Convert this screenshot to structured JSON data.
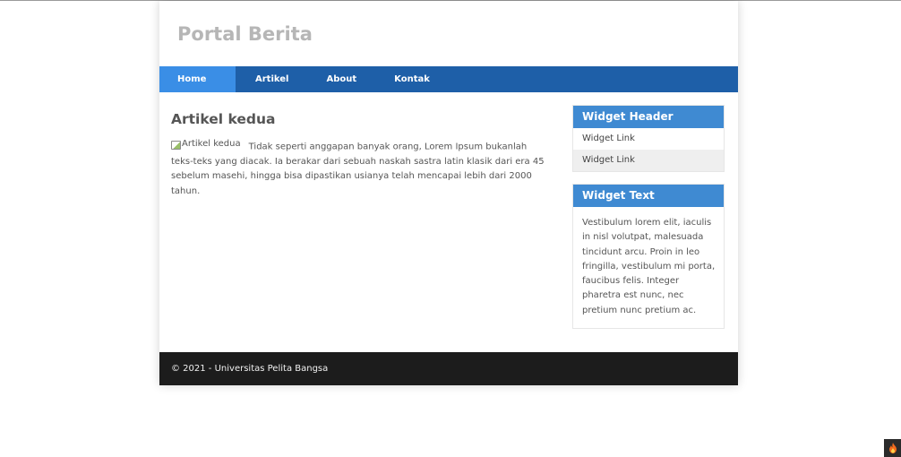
{
  "site": {
    "title": "Portal Berita"
  },
  "nav": {
    "items": [
      {
        "label": "Home",
        "active": true
      },
      {
        "label": "Artikel",
        "active": false
      },
      {
        "label": "About",
        "active": false
      },
      {
        "label": "Kontak",
        "active": false
      }
    ]
  },
  "article": {
    "title": "Artikel kedua",
    "image_alt": "Artikel kedua",
    "body": "Tidak seperti anggapan banyak orang, Lorem Ipsum bukanlah teks-teks yang diacak. Ia berakar dari sebuah naskah sastra latin klasik dari era 45 sebelum masehi, hingga bisa dipastikan usianya telah mencapai lebih dari 2000 tahun."
  },
  "sidebar": {
    "widget_links": {
      "header": "Widget Header",
      "links": [
        "Widget Link",
        "Widget Link"
      ]
    },
    "widget_text": {
      "header": "Widget Text",
      "body": "Vestibulum lorem elit, iaculis in nisl volutpat, malesuada tincidunt arcu. Proin in leo fringilla, vestibulum mi porta, faucibus felis. Integer pharetra est nunc, nec pretium nunc pretium ac."
    }
  },
  "footer": {
    "text": "© 2021 - Universitas Pelita Bangsa"
  },
  "colors": {
    "nav_bg": "#1e5fa8",
    "nav_active": "#3a8ee6",
    "widget_header": "#3f8ad2",
    "footer_bg": "#1c1c1c"
  },
  "icons": {
    "corner_badge": "flame-icon",
    "broken_image": "broken-image-icon"
  }
}
